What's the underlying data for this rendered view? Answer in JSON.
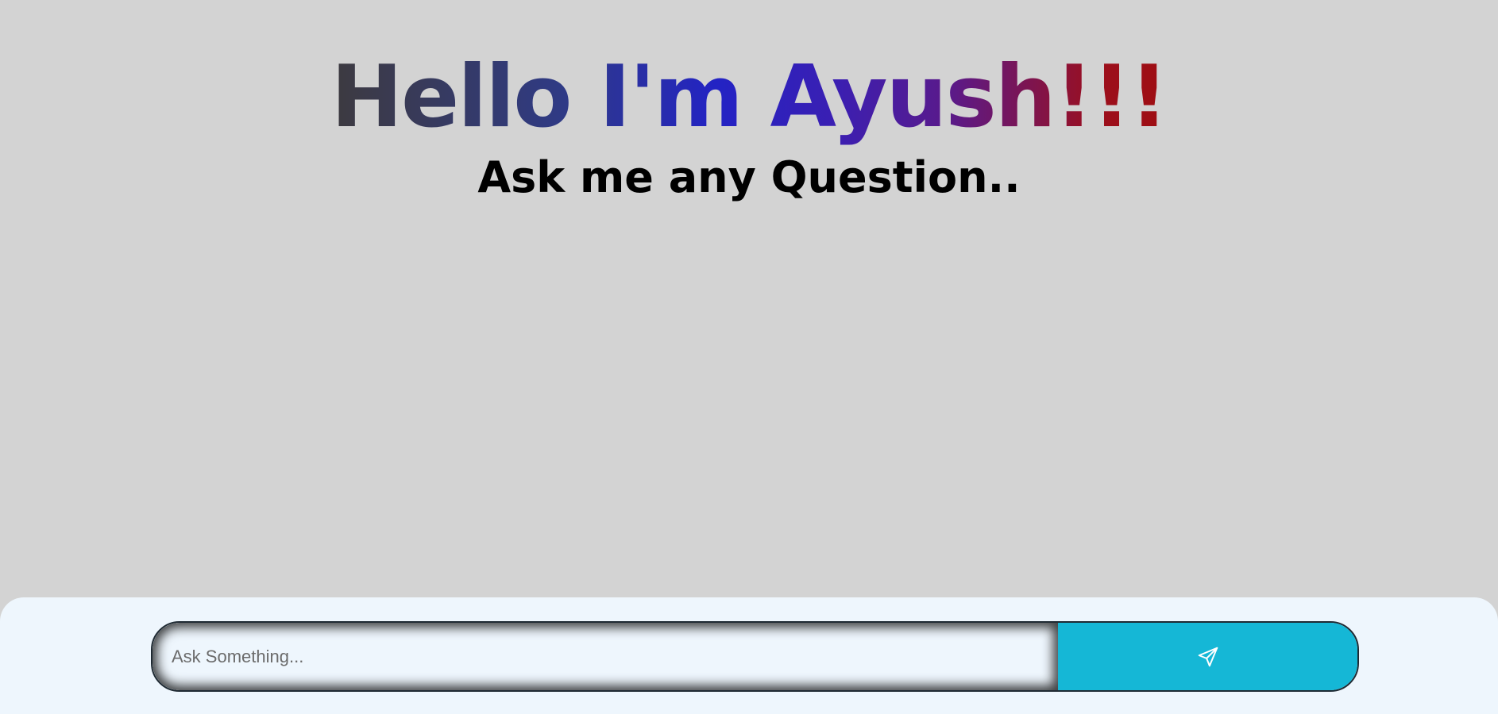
{
  "hero": {
    "title": "Hello I'm Ayush!!!",
    "subtitle": "Ask me any Question.."
  },
  "chat_input": {
    "placeholder": "Ask Something...",
    "value": ""
  },
  "send_button": {
    "icon": "send-icon"
  },
  "colors": {
    "page_background": "#d3d3d3",
    "panel_background": "#eef6fd",
    "send_button": "#15b7d6",
    "title_gradient": [
      "#3d3a3f",
      "#2f3a86",
      "#2323c4",
      "#5a1a8a",
      "#9f0d12"
    ]
  }
}
